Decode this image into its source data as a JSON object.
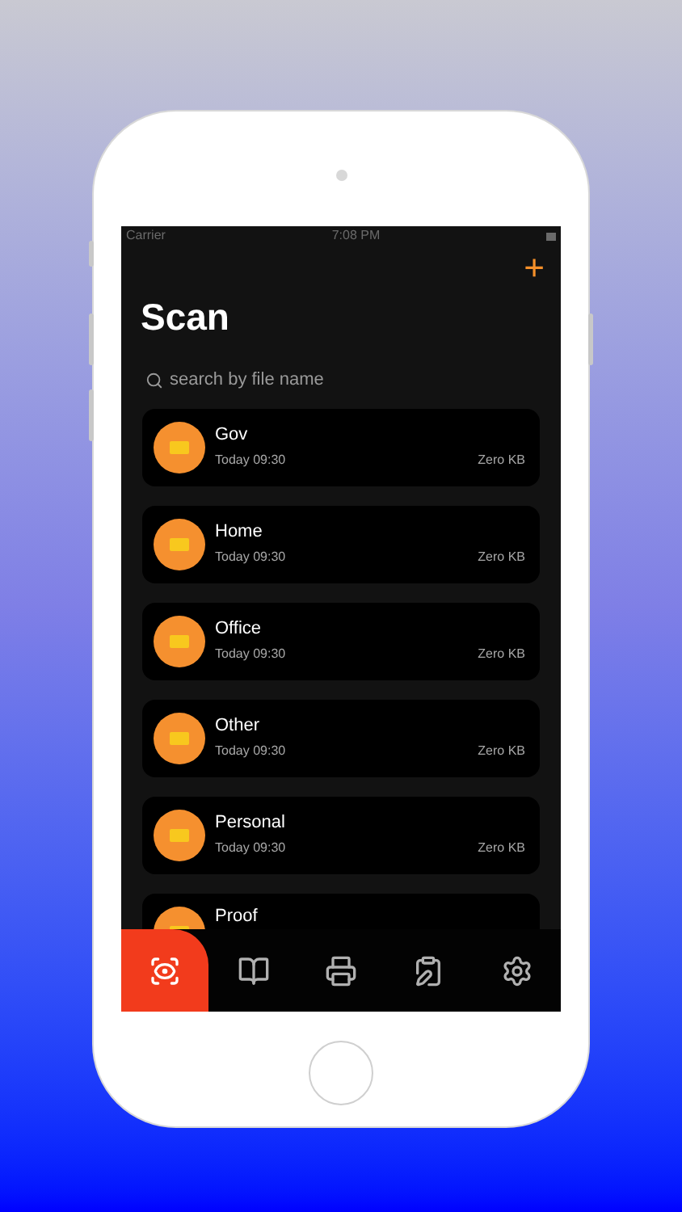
{
  "status_bar": {
    "carrier": "Carrier",
    "time": "7:08 PM"
  },
  "header": {
    "add": "+",
    "title": "Scan"
  },
  "search": {
    "placeholder": "search by file name"
  },
  "folders": [
    {
      "name": "Gov",
      "date": "Today 09:30",
      "size": "Zero KB"
    },
    {
      "name": "Home",
      "date": "Today 09:30",
      "size": "Zero KB"
    },
    {
      "name": "Office",
      "date": "Today 09:30",
      "size": "Zero KB"
    },
    {
      "name": "Other",
      "date": "Today 09:30",
      "size": "Zero KB"
    },
    {
      "name": "Personal",
      "date": "Today 09:30",
      "size": "Zero KB"
    },
    {
      "name": "Proof"
    }
  ],
  "tabs": [
    {
      "kind": "scan",
      "selected": true
    },
    {
      "kind": "library",
      "selected": false
    },
    {
      "kind": "scanner",
      "selected": false
    },
    {
      "kind": "notes",
      "selected": false
    },
    {
      "kind": "settings",
      "selected": false
    }
  ]
}
